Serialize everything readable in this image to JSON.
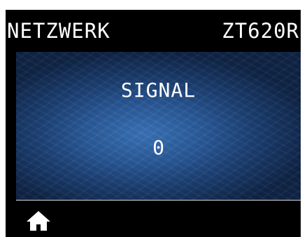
{
  "header": {
    "title": "NETZWERK",
    "model": "ZT620R"
  },
  "main": {
    "label": "SIGNAL",
    "value": "0"
  },
  "footer": {
    "home_icon": "home-icon"
  },
  "colors": {
    "screen_background": "#000000",
    "panel_center": "#3a73b8",
    "panel_edge": "#0f2446",
    "text": "#ffffff",
    "divider": "#d8d8d8"
  }
}
